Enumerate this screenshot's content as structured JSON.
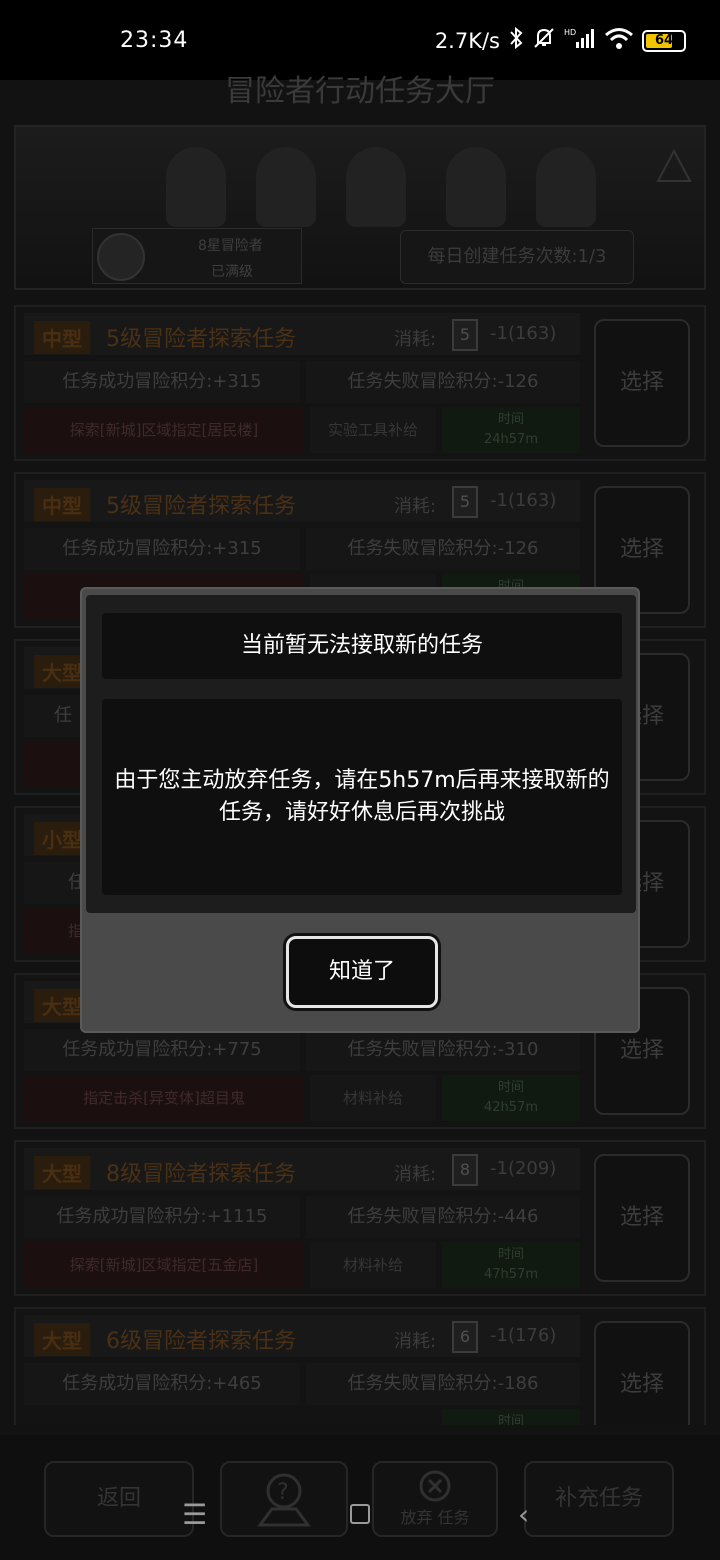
{
  "status_bar": {
    "time": "23:34",
    "net_speed": "2.7K/s",
    "battery": "64",
    "icons": [
      "bluetooth-icon",
      "mute-icon",
      "hd-signal-icon",
      "wifi-icon",
      "battery-icon"
    ]
  },
  "app": {
    "title": "冒险者行动任务大厅",
    "player": {
      "rank": "8星冒险者",
      "level_status": "已满级"
    },
    "daily_create": "每日创建任务次数:1/3",
    "cost_label": "消耗:",
    "select_label": "选择",
    "time_label": "时间",
    "tasks": [
      {
        "size": "中型",
        "name": "5级冒险者探索任务",
        "cost_card": "5",
        "cost": "-1(163)",
        "success": "任务成功冒险积分:+315",
        "fail": "任务失败冒险积分:-126",
        "goal": "探索[新城]区域指定[居民楼]",
        "reward": "实验工具补给",
        "time": "24h57m"
      },
      {
        "size": "中型",
        "name": "5级冒险者探索任务",
        "cost_card": "5",
        "cost": "-1(163)",
        "success": "任务成功冒险积分:+315",
        "fail": "任务失败冒险积分:-126",
        "goal": "探",
        "reward": "",
        "time": ""
      },
      {
        "size": "大型",
        "name": "",
        "cost_card": "",
        "cost": "",
        "success": "任",
        "fail": "",
        "goal": "",
        "reward": "",
        "time": ""
      },
      {
        "size": "小型",
        "name": "",
        "cost_card": "",
        "cost": "",
        "success": "任",
        "fail": "",
        "goal": "指",
        "reward": "",
        "time": ""
      },
      {
        "size": "大型",
        "name": "",
        "cost_card": "",
        "cost": "",
        "success": "任务成功冒险积分:+775",
        "fail": "任务失败冒险积分:-310",
        "goal": "指定击杀[异变体]超目鬼",
        "reward": "材料补给",
        "time": "42h57m"
      },
      {
        "size": "大型",
        "name": "8级冒险者探索任务",
        "cost_card": "8",
        "cost": "-1(209)",
        "success": "任务成功冒险积分:+1115",
        "fail": "任务失败冒险积分:-446",
        "goal": "探索[新城]区域指定[五金店]",
        "reward": "材料补给",
        "time": "47h57m"
      },
      {
        "size": "大型",
        "name": "6级冒险者探索任务",
        "cost_card": "6",
        "cost": "-1(176)",
        "success": "任务成功冒险积分:+465",
        "fail": "任务失败冒险积分:-186",
        "goal": "",
        "reward": "",
        "time": ""
      }
    ],
    "bottom": {
      "back": "返回",
      "abandon": "放弃 任务",
      "refill": "补充任务"
    }
  },
  "dialog": {
    "title": "当前暂无法接取新的任务",
    "message": "由于您主动放弃任务，请在5h57m后再来接取新的任务，请好好休息后再次挑战",
    "ok": "知道了"
  },
  "nav": {
    "menu": "☰",
    "back": "‹"
  }
}
